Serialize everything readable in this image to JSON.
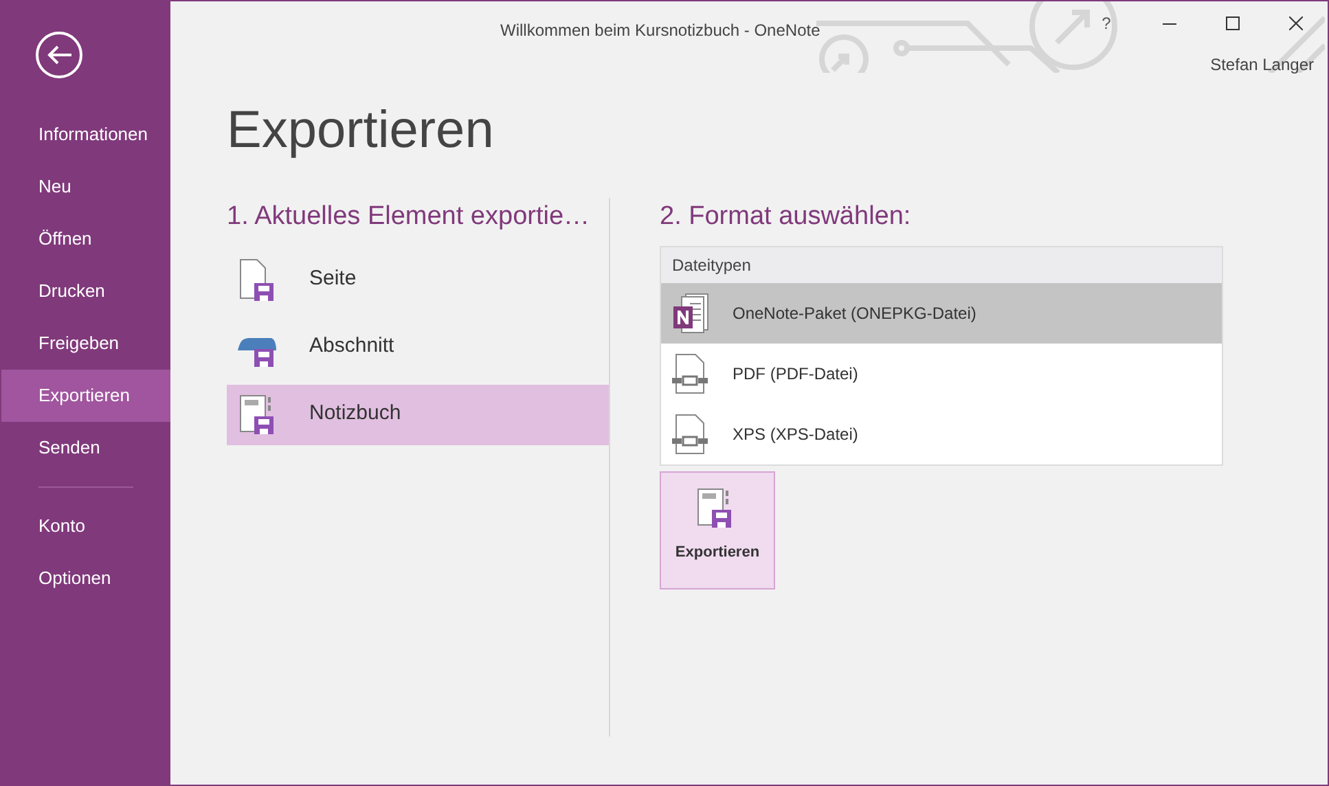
{
  "window": {
    "title": "Willkommen beim Kursnotizbuch - OneNote",
    "help": "?",
    "user": "Stefan Langer"
  },
  "sidebar": {
    "items": [
      {
        "label": "Informationen",
        "selected": false
      },
      {
        "label": "Neu",
        "selected": false
      },
      {
        "label": "Öffnen",
        "selected": false
      },
      {
        "label": "Drucken",
        "selected": false
      },
      {
        "label": "Freigeben",
        "selected": false
      },
      {
        "label": "Exportieren",
        "selected": true
      },
      {
        "label": "Senden",
        "selected": false
      }
    ],
    "bottom_items": [
      {
        "label": "Konto",
        "selected": false
      },
      {
        "label": "Optionen",
        "selected": false
      }
    ]
  },
  "page_title": "Exportieren",
  "export_scope": {
    "heading": "1. Aktuelles Element exportie…",
    "items": [
      {
        "label": "Seite",
        "kind": "page",
        "selected": false
      },
      {
        "label": "Abschnitt",
        "kind": "section",
        "selected": false
      },
      {
        "label": "Notizbuch",
        "kind": "notebook",
        "selected": true
      }
    ]
  },
  "format": {
    "heading": "2. Format auswählen:",
    "list_header": "Dateitypen",
    "items": [
      {
        "label": "OneNote-Paket (ONEPKG-Datei)",
        "kind": "onenote",
        "selected": true
      },
      {
        "label": "PDF (PDF-Datei)",
        "kind": "document",
        "selected": false
      },
      {
        "label": "XPS (XPS-Datei)",
        "kind": "document",
        "selected": false
      }
    ]
  },
  "export_button": "Exportieren"
}
